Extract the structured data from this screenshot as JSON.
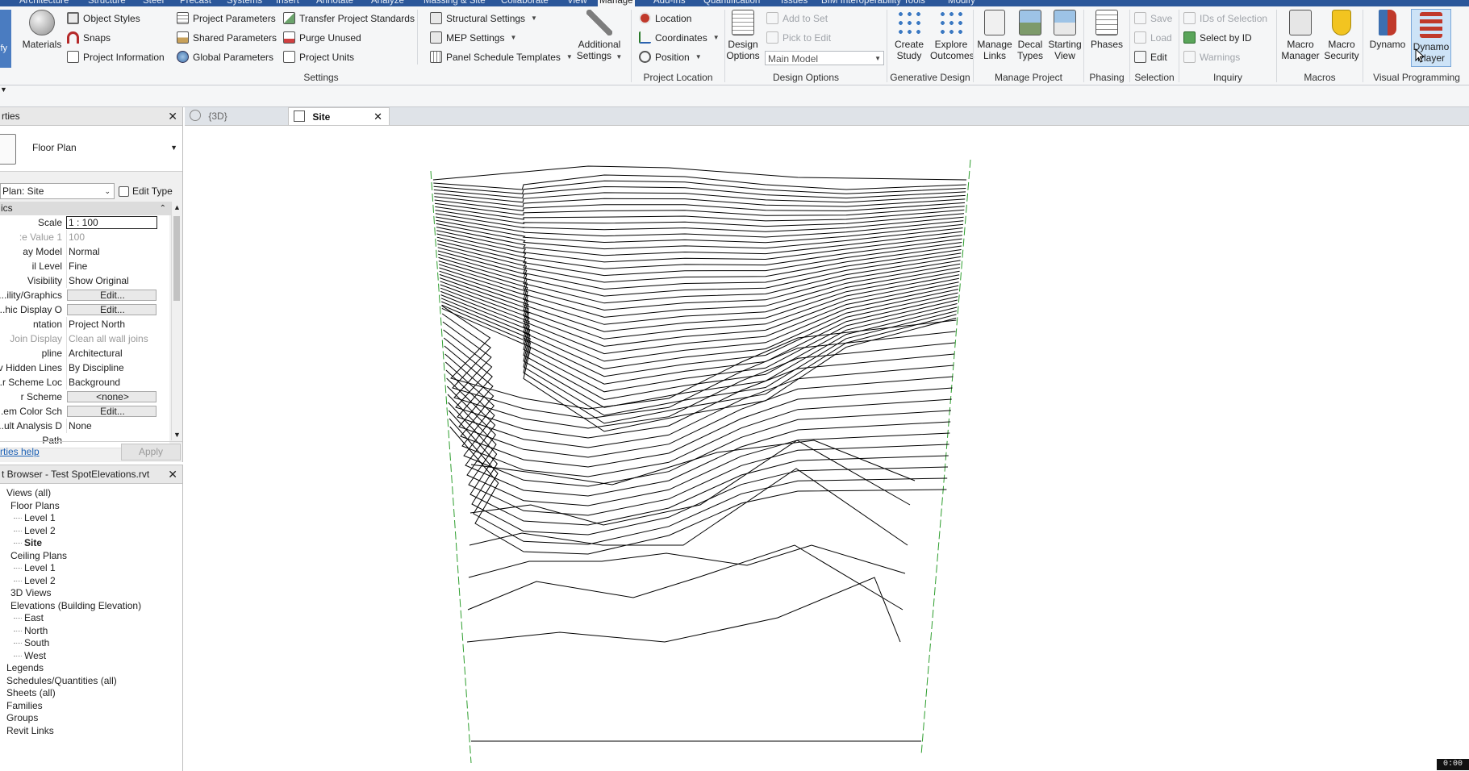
{
  "ribbon_tabs": [
    "Architecture",
    "Structure",
    "Steel",
    "Precast",
    "Systems",
    "Insert",
    "Annotate",
    "Analyze",
    "Massing & Site",
    "Collaborate",
    "View",
    "Manage",
    "Add-Ins",
    "Quantification",
    "Issues",
    "BIM Interoperability Tools",
    "Modify"
  ],
  "active_tab": "Manage",
  "modify_label": "ify",
  "settings_panel": {
    "title": "Settings",
    "materials": "Materials",
    "object_styles": "Object  Styles",
    "snaps": "Snaps",
    "project_information": "Project  Information",
    "project_parameters": "Project  Parameters",
    "shared_parameters": "Shared  Parameters",
    "global_parameters": "Global  Parameters",
    "transfer_project_standards": "Transfer  Project Standards",
    "purge_unused": "Purge  Unused",
    "project_units": "Project  Units",
    "structural_settings": "Structural  Settings",
    "mep_settings": "MEP  Settings",
    "panel_schedule_templates": "Panel Schedule  Templates",
    "additional_settings_line1": "Additional",
    "additional_settings_line2": "Settings"
  },
  "project_location_panel": {
    "title": "Project Location",
    "location": "Location",
    "coordinates": "Coordinates",
    "position": "Position"
  },
  "design_options_panel": {
    "title": "Design Options",
    "design_options_line1": "Design",
    "design_options_line2": "Options",
    "add_to_set": "Add to Set",
    "pick_to_edit": "Pick to Edit",
    "main_model": "Main Model"
  },
  "generative_design_panel": {
    "title": "Generative Design",
    "create_study_line1": "Create",
    "create_study_line2": "Study",
    "explore_outcomes_line1": "Explore",
    "explore_outcomes_line2": "Outcomes"
  },
  "manage_project_panel": {
    "title": "Manage Project",
    "manage_links_line1": "Manage",
    "manage_links_line2": "Links",
    "decal_types_line1": "Decal",
    "decal_types_line2": "Types",
    "starting_view_line1": "Starting",
    "starting_view_line2": "View"
  },
  "phasing_panel": {
    "title": "Phasing",
    "phases": "Phases"
  },
  "selection_panel": {
    "title": "Selection",
    "save": "Save",
    "load": "Load",
    "edit": "Edit"
  },
  "inquiry_panel": {
    "title": "Inquiry",
    "ids_of_selection": "IDs of  Selection",
    "select_by_id": "Select  by ID",
    "warnings": "Warnings"
  },
  "macros_panel": {
    "title": "Macros",
    "macro_manager_line1": "Macro",
    "macro_manager_line2": "Manager",
    "macro_security_line1": "Macro",
    "macro_security_line2": "Security"
  },
  "visual_programming_panel": {
    "title": "Visual Programming",
    "dynamo": "Dynamo",
    "dynamo_player_line1": "Dynamo",
    "dynamo_player_line2": "Player"
  },
  "properties": {
    "title": "rties",
    "type_name": "Floor Plan",
    "plan_selector": "Plan: Site",
    "edit_type": "Edit Type",
    "group": "ics",
    "rows": [
      {
        "key": "Scale",
        "value": "1 : 100",
        "style": "boxed"
      },
      {
        "key": "e Value   1:",
        "value": "100",
        "style": "gray"
      },
      {
        "key": "ay Model",
        "value": "Normal",
        "style": ""
      },
      {
        "key": "il Level",
        "value": "Fine",
        "style": ""
      },
      {
        "key": " Visibility",
        "value": "Show Original",
        "style": ""
      },
      {
        "key": "ility/Graphics...",
        "value": "Edit...",
        "style": "button"
      },
      {
        "key": "hic Display O...",
        "value": "Edit...",
        "style": "button"
      },
      {
        "key": "ntation",
        "value": "Project North",
        "style": ""
      },
      {
        "key": "Join Display",
        "value": "Clean all wall joins",
        "style": "gray"
      },
      {
        "key": "pline",
        "value": "Architectural",
        "style": ""
      },
      {
        "key": "v Hidden Lines",
        "value": "By Discipline",
        "style": ""
      },
      {
        "key": "r Scheme Loc...",
        "value": "Background",
        "style": ""
      },
      {
        "key": "r Scheme",
        "value": "<none>",
        "style": "button"
      },
      {
        "key": "em Color Sch...",
        "value": "Edit...",
        "style": "button"
      },
      {
        "key": "ult Analysis D...",
        "value": "None",
        "style": ""
      },
      {
        "key": "Path",
        "value": "",
        "style": ""
      }
    ],
    "help": "rties help",
    "apply": "Apply"
  },
  "browser": {
    "title": "t Browser - Test SpotElevations.rvt",
    "items": [
      {
        "label": "Views (all)",
        "level": 0,
        "bold": false
      },
      {
        "label": "Floor Plans",
        "level": 1,
        "bold": false
      },
      {
        "label": "Level 1",
        "level": 2,
        "bold": false
      },
      {
        "label": "Level 2",
        "level": 2,
        "bold": false
      },
      {
        "label": "Site",
        "level": 2,
        "bold": true
      },
      {
        "label": "Ceiling Plans",
        "level": 1,
        "bold": false
      },
      {
        "label": "Level 1",
        "level": 2,
        "bold": false
      },
      {
        "label": "Level 2",
        "level": 2,
        "bold": false
      },
      {
        "label": "3D Views",
        "level": 1,
        "bold": false
      },
      {
        "label": "Elevations (Building Elevation)",
        "level": 1,
        "bold": false
      },
      {
        "label": "East",
        "level": 2,
        "bold": false
      },
      {
        "label": "North",
        "level": 2,
        "bold": false
      },
      {
        "label": "South",
        "level": 2,
        "bold": false
      },
      {
        "label": "West",
        "level": 2,
        "bold": false
      },
      {
        "label": "Legends",
        "level": 0,
        "bold": false
      },
      {
        "label": "Schedules/Quantities (all)",
        "level": 0,
        "bold": false
      },
      {
        "label": "Sheets (all)",
        "level": 0,
        "bold": false
      },
      {
        "label": "Families",
        "level": 0,
        "bold": false
      },
      {
        "label": "Groups",
        "level": 0,
        "bold": false
      },
      {
        "label": "Revit Links",
        "level": 0,
        "bold": false
      }
    ]
  },
  "view_tabs": [
    {
      "label": "{3D}",
      "active": false
    },
    {
      "label": "Site",
      "active": true
    }
  ],
  "timer": "0:00",
  "colors": {
    "ribbon_tabbar": "#2b579a",
    "ribbon_bg": "#f5f6f7",
    "canvas_bg": "#ffffff",
    "contour_line": "#000000",
    "boundary_dash": "#2e9e2e",
    "selected_button": "#cde3f7"
  }
}
